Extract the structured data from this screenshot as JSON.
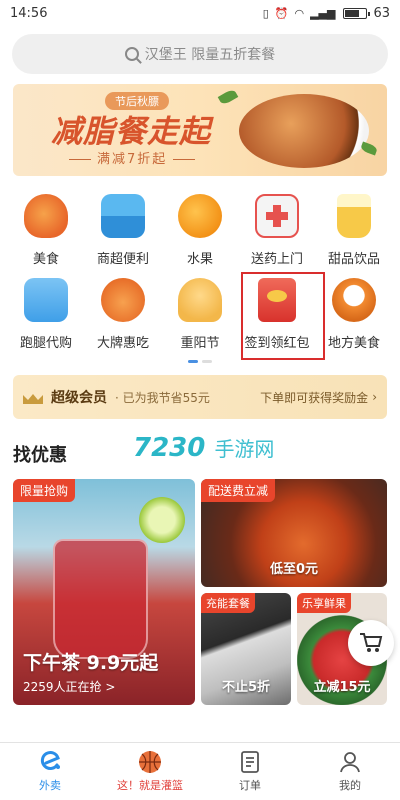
{
  "status_bar": {
    "time": "14:56",
    "battery": "63"
  },
  "search": {
    "placeholder": "汉堡王 限量五折套餐"
  },
  "banner": {
    "tag": "节后秋膘",
    "title": "减脂餐走起",
    "subtitle": "满减7折起"
  },
  "categories": [
    {
      "label": "美食",
      "icon": "chicken-leg-icon",
      "color": "#f07a2a"
    },
    {
      "label": "商超便利",
      "icon": "store-icon",
      "color": "#3fa4e8"
    },
    {
      "label": "水果",
      "icon": "orange-icon",
      "color": "#f5a623"
    },
    {
      "label": "送药上门",
      "icon": "medicine-box-icon",
      "color": "#e6524e"
    },
    {
      "label": "甜品饮品",
      "icon": "drink-icon",
      "color": "#f7c948"
    },
    {
      "label": "跑腿代购",
      "icon": "delivery-box-icon",
      "color": "#3f9fe8"
    },
    {
      "label": "大牌惠吃",
      "icon": "pumpkin-icon",
      "color": "#f08a3a"
    },
    {
      "label": "重阳节",
      "icon": "pastry-icon",
      "color": "#f3b74a"
    },
    {
      "label": "签到领红包",
      "icon": "red-envelope-icon",
      "color": "#e8453c"
    },
    {
      "label": "地方美食",
      "icon": "bowl-icon",
      "color": "#f28a30"
    }
  ],
  "vip": {
    "title": "超级会员",
    "desc": "· 已为我节省55元",
    "cta": "下单即可获得奖励金"
  },
  "section_title": "找优惠",
  "watermark": {
    "number": "7230",
    "text": "手游网"
  },
  "deals": {
    "big": {
      "tag": "限量抢购",
      "title": "下午茶 9.9元起",
      "subtitle": "2259人正在抢 >"
    },
    "top": {
      "tag": "配送费立减",
      "caption": "低至0元"
    },
    "small_a": {
      "tag": "充能套餐",
      "caption": "不止5折"
    },
    "small_b": {
      "tag": "乐享鲜果",
      "caption": "立减15元"
    }
  },
  "tabs": [
    {
      "label": "外卖",
      "icon": "eleme-logo-icon",
      "active": true
    },
    {
      "label": "这！就是灌篮",
      "icon": "basketball-icon",
      "active": false
    },
    {
      "label": "订单",
      "icon": "order-list-icon",
      "active": false
    },
    {
      "label": "我的",
      "icon": "user-icon",
      "active": false
    }
  ]
}
